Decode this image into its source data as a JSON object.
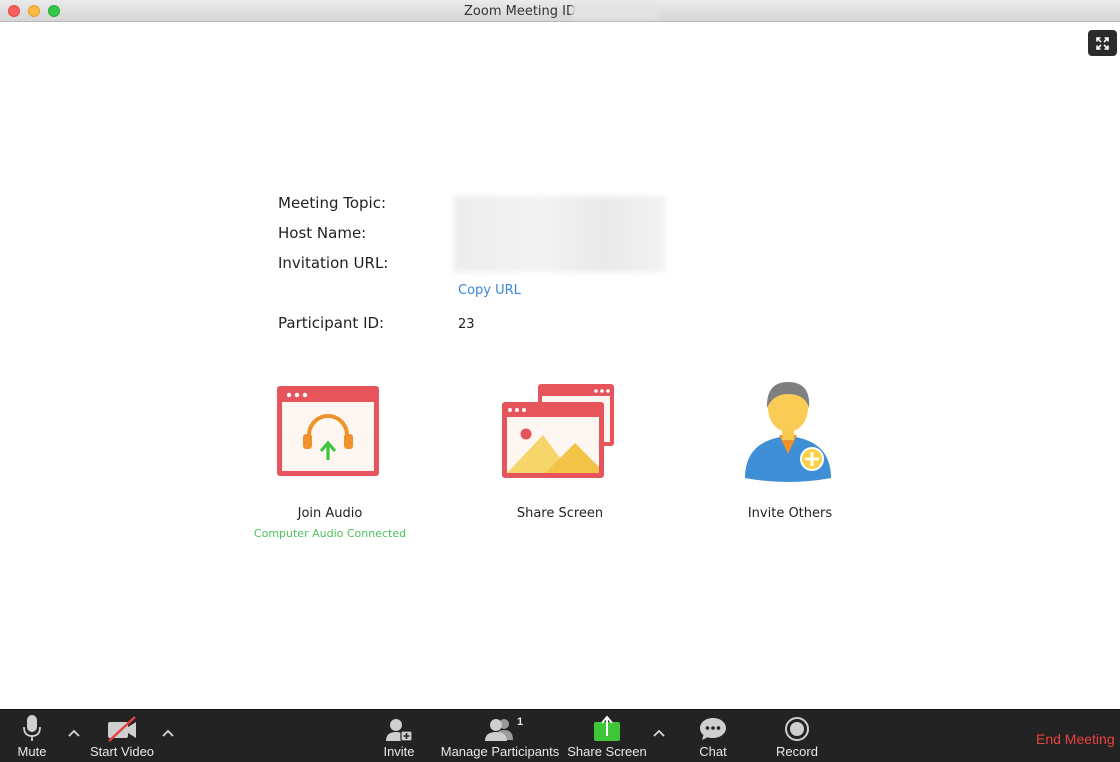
{
  "window": {
    "title": "Zoom Meeting ID:"
  },
  "info": {
    "meeting_topic_label": "Meeting Topic:",
    "host_name_label": "Host Name:",
    "invitation_url_label": "Invitation URL:",
    "copy_url_label": "Copy URL",
    "participant_id_label": "Participant ID:",
    "participant_id_value": "23"
  },
  "actions": {
    "join_audio_label": "Join Audio",
    "audio_status": "Computer Audio Connected",
    "share_screen_label": "Share Screen",
    "invite_others_label": "Invite Others"
  },
  "toolbar": {
    "mute_label": "Mute",
    "start_video_label": "Start Video",
    "invite_label": "Invite",
    "manage_participants_label": "Manage Participants",
    "participant_count": "1",
    "share_screen_label": "Share Screen",
    "chat_label": "Chat",
    "record_label": "Record",
    "end_meeting_label": "End Meeting"
  },
  "colors": {
    "accent_red": "#e8423f",
    "link_blue": "#3a87d6",
    "status_green": "#4bc25e",
    "share_green": "#3ec53a",
    "tile_red": "#e7555c",
    "toolbar_bg": "#232323"
  },
  "icons": {
    "fullscreen": "expand-icon",
    "join_audio": "headphones-icon",
    "share_screen": "share-screen-icon",
    "invite_others": "add-user-icon",
    "mute": "microphone-icon",
    "video": "video-off-icon",
    "invite": "add-user-icon",
    "participants": "participants-icon",
    "share": "share-upload-icon",
    "chat": "chat-bubble-icon",
    "record": "record-icon"
  }
}
